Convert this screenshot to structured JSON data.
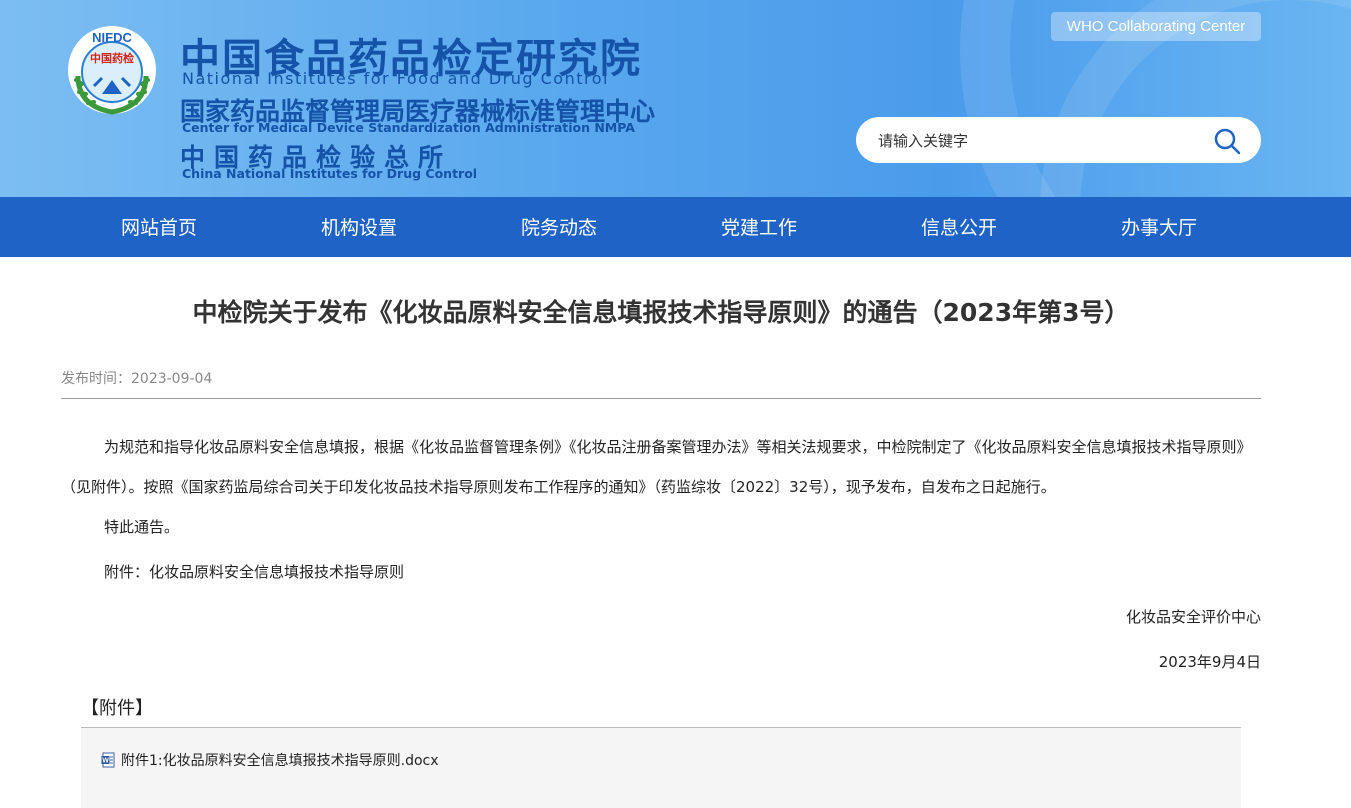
{
  "header": {
    "logo_top_text": "NIFDC",
    "logo_center_text": "中国药检",
    "title_cn_1": "中国食品药品检定研究院",
    "title_en_1": "National Institutes for Food and Drug Control",
    "title_cn_2": "国家药品监督管理局医疗器械标准管理中心",
    "title_en_2": "Center for Medical Device Standardization Administration NMPA",
    "title_cn_3": "中国药品检验总所",
    "title_en_3": "China National Institutes for Drug Control",
    "who_badge": "WHO Collaborating Center",
    "search_placeholder": "请输入关键字",
    "colors": {
      "header_blue": "#5aa8ee",
      "brand_text": "#1453a8"
    }
  },
  "nav": {
    "color": "#1f63c6",
    "items": [
      {
        "label": "网站首页"
      },
      {
        "label": "机构设置"
      },
      {
        "label": "院务动态"
      },
      {
        "label": "党建工作"
      },
      {
        "label": "信息公开"
      },
      {
        "label": "办事大厅"
      }
    ]
  },
  "article": {
    "title": "中检院关于发布《化妆品原料安全信息填报技术指导原则》的通告（2023年第3号）",
    "meta_label": "发布时间：",
    "publish_date": "2023-09-04",
    "paragraph_1": "为规范和指导化妆品原料安全信息填报，根据《化妆品监督管理条例》《化妆品注册备案管理办法》等相关法规要求，中检院制定了《化妆品原料安全信息填报技术指导原则》（见附件）。按照《国家药监局综合司关于印发化妆品技术指导原则发布工作程序的通知》（药监综妆〔2022〕32号），现予发布，自发布之日起施行。",
    "paragraph_2": "特此通告。",
    "paragraph_3": "附件：化妆品原料安全信息填报技术指导原则",
    "signature_org": "化妆品安全评价中心",
    "signature_date": "2023年9月4日"
  },
  "attachments": {
    "title": "【附件】",
    "items": [
      {
        "label": "附件1:化妆品原料安全信息填报技术指导原则.docx",
        "icon": "word-doc-icon"
      }
    ]
  }
}
